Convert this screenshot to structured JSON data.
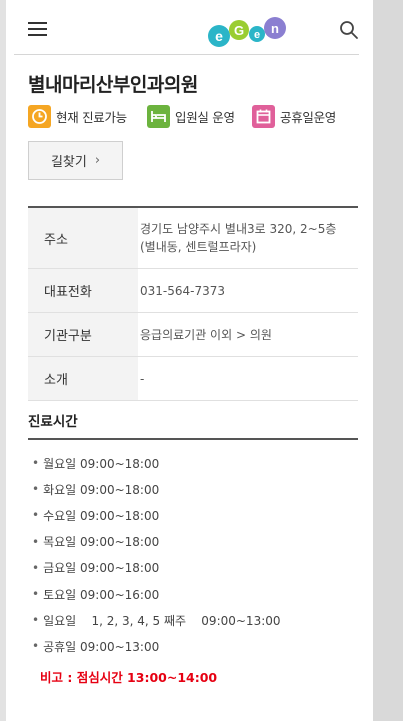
{
  "hospital": {
    "name": "별내마리산부인과의원"
  },
  "badges": [
    {
      "label": "현재 진료가능",
      "icon": "clock-icon",
      "color": "#f5a623"
    },
    {
      "label": "입원실 운영",
      "icon": "bed-icon",
      "color": "#6cb33e"
    },
    {
      "label": "공휴일운영",
      "icon": "calendar-icon",
      "color": "#e0609a"
    }
  ],
  "route_button": {
    "label": "길찾기",
    "chevron": "›"
  },
  "info": [
    {
      "label": "주소",
      "value": "경기도 남양주시 별내3로 320, 2~5층 (별내동, 센트럴프라자)"
    },
    {
      "label": "대표전화",
      "value": "031-564-7373"
    },
    {
      "label": "기관구분",
      "value": "응급의료기관 이외 > 의원"
    },
    {
      "label": "소개",
      "value": "-"
    }
  ],
  "hours": {
    "title": "진료시간",
    "items": [
      "월요일 09:00~18:00",
      "화요일 09:00~18:00",
      "수요일 09:00~18:00",
      "목요일 09:00~18:00",
      "금요일 09:00~18:00",
      "토요일 09:00~16:00",
      "일요일    1, 2, 3, 4, 5 째주    09:00~13:00",
      "공휴일 09:00~13:00"
    ],
    "note": "비고 : 점심시간 13:00~14:00"
  },
  "colors": {
    "note": "#e60012",
    "logo_teal": "#2bb5c8",
    "logo_green": "#9acd32",
    "logo_purple": "#8b7fd1"
  },
  "icons": {
    "menu": "hamburger-menu-icon",
    "search": "search-icon",
    "logo": "egen-logo"
  }
}
